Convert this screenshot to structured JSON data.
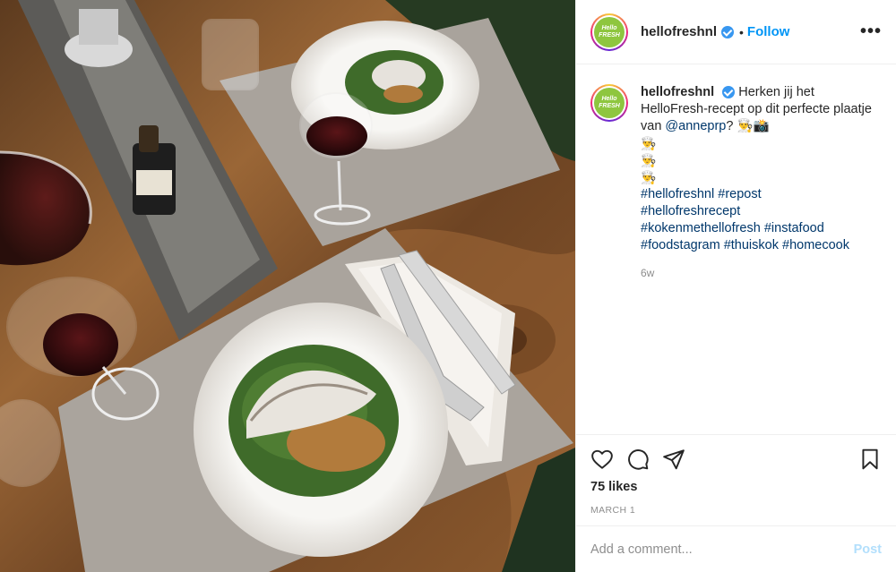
{
  "photo": {
    "alt_kind": "food-photo",
    "colors": {
      "wood": "#7b5230",
      "placemat": "#a8a29c",
      "plate": "#f4f2ef",
      "greens": "#3f6b2a",
      "wine": "#3a0d10",
      "napkin": "#ece8e2"
    }
  },
  "header": {
    "username": "hellofreshnl",
    "separator": "•",
    "follow_label": "Follow",
    "more_label": "•••",
    "avatar_text_1": "Hello",
    "avatar_text_2": "FRESH"
  },
  "caption": {
    "username": "hellofreshnl",
    "text_1": "Herken jij het HelloFresh-recept op dit perfecte plaatje van",
    "mention": "@anneprp",
    "text_2": "?",
    "emoji_1": "👨‍🍳📸",
    "emoji_2": "👨‍🍳",
    "emoji_3": "👨‍🍳",
    "emoji_4": "👨‍🍳",
    "hashtags": [
      "#hellofreshnl",
      "#repost",
      "#hellofreshrecept",
      "#kokenmethellofresh",
      "#instafood",
      "#foodstagram",
      "#thuiskok",
      "#homecook"
    ],
    "time_ago": "6w"
  },
  "actions": {
    "like_icon": "heart-icon",
    "comment_icon": "comment-icon",
    "share_icon": "paper-plane-icon",
    "save_icon": "bookmark-icon",
    "likes": "75 likes",
    "date": "MARCH 1"
  },
  "comment": {
    "placeholder": "Add a comment...",
    "post_label": "Post"
  },
  "colors": {
    "accent": "#0095f6",
    "verified": "#3897f0",
    "post_disabled": "#b2dffc",
    "hashtag": "#00376b",
    "muted": "#8e8e8e",
    "brand_green": "#8ec63f"
  }
}
